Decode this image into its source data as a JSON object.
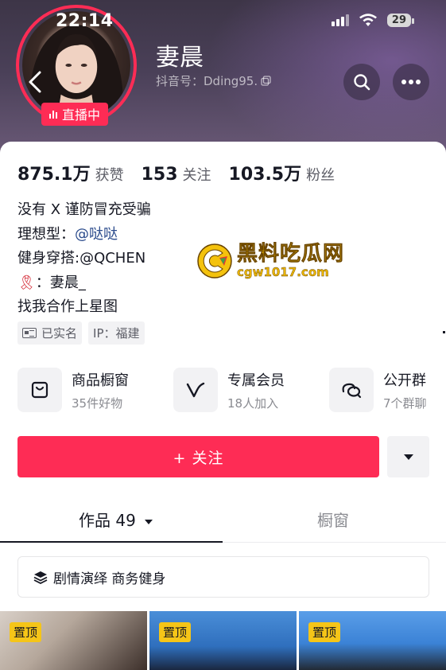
{
  "status_bar": {
    "time": "22:14",
    "battery": "29"
  },
  "profile": {
    "name": "妻晨",
    "douyin_id": "抖音号：Dding95.",
    "live_badge": "直播中"
  },
  "stats": [
    {
      "value": "875.1万",
      "label": "获赞"
    },
    {
      "value": "153",
      "label": "关注"
    },
    {
      "value": "103.5万",
      "label": "粉丝"
    }
  ],
  "bio": {
    "line1": "没有 X 谨防冒充受骗",
    "line2_prefix": "理想型：",
    "line2_mention": "@哒哒",
    "line3": "健身穿搭:@QCHEN",
    "line4_emoji": "🎗",
    "line4_text": "：妻晨_",
    "line5": "找我合作上星图"
  },
  "tags": [
    {
      "label": "已实名",
      "icon": "id-card-icon"
    },
    {
      "label": "IP：福建"
    }
  ],
  "features": [
    {
      "title": "商品橱窗",
      "sub": "35件好物",
      "icon": "shopping-bag-icon"
    },
    {
      "title": "专属会员",
      "sub": "18人加入",
      "icon": "vip-v-icon"
    },
    {
      "title": "公开群",
      "sub": "7个群聊",
      "icon": "chat-bubbles-icon"
    }
  ],
  "follow_button": "+ 关注",
  "tabs": {
    "works": "作品 49",
    "window": "橱窗"
  },
  "collection": "剧情演绎 商务健身",
  "grid": [
    {
      "pin": "置顶"
    },
    {
      "pin": "置顶"
    },
    {
      "pin": "置顶"
    }
  ],
  "watermark": {
    "title": "黑料吃瓜网",
    "url": "cgw1017.com"
  },
  "colors": {
    "accent": "#fe2c55",
    "link": "#2b4b8c",
    "pin": "#f5c518"
  }
}
